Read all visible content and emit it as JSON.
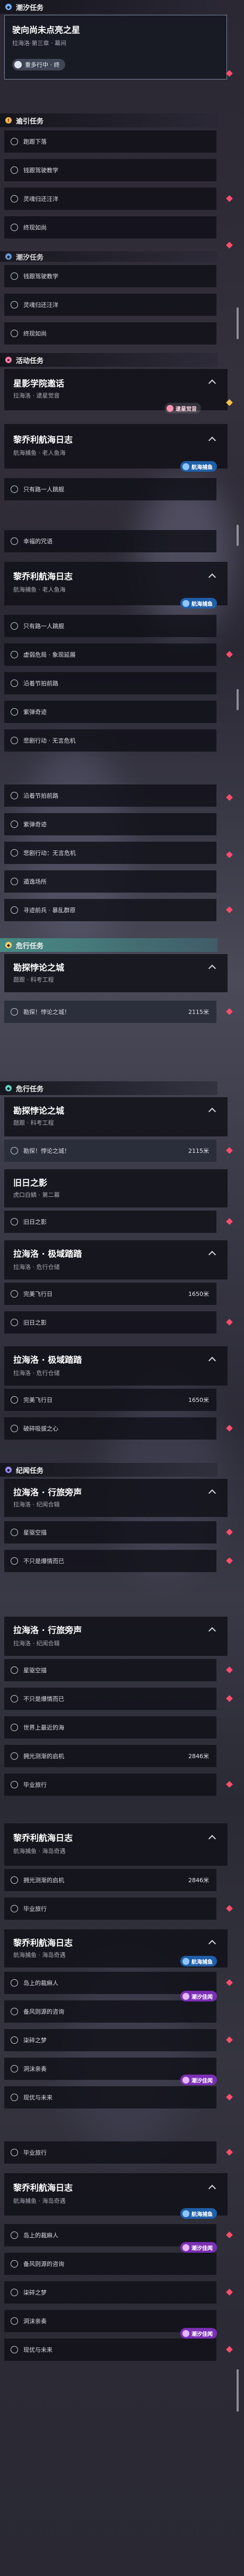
{
  "colors": {
    "accent_red": "#ff4d6d",
    "accent_teal": "#5fd4c4",
    "tag_blue": "#1f5fa8",
    "tag_purple": "#7b2fb5"
  },
  "sections": {
    "tide": "潮汐任务",
    "wander": "逾引任务",
    "activity": "活动任务",
    "realm": "危行任务",
    "side": "危行任务",
    "legend": "纪闻任务"
  },
  "top": {
    "title": "驶向尚未点亮之星",
    "subtitle": "拉海洛·第三章 · 幕间",
    "pill": "重多行中 · 终"
  },
  "wander_list": [
    "跑跟下落",
    "钱跟驾驶教学",
    "灵魂归还汪洋",
    "终现如尚"
  ],
  "wander_list2": [
    "钱跟驾驶教学",
    "灵魂归还汪洋",
    "终现如尚"
  ],
  "star_academy": {
    "title": "星影学院邀话",
    "subtitle": "拉海洛 · 逮星觉音",
    "tag": "逮星觉音"
  },
  "log1": {
    "title": "黎乔利航海日志",
    "subtitle": "航海捕鱼 · 老人鱼海",
    "tag": "航海捕鱼",
    "item": "只有路一人跳舰"
  },
  "mid_single": "幸福的咒语",
  "log2": {
    "title": "黎乔利航海日志",
    "subtitle": "航海捕鱼 · 老人鱼海",
    "tag": "航海捕鱼",
    "items": [
      "只有路一人跳舰",
      "虚弱危局 · 象现延展",
      "沿着节拍前路",
      "紫弹奇迹",
      "悲剧行动 · 无言危机"
    ]
  },
  "mid_list": [
    "沿着节拍前路",
    "紫弹奇迹",
    "悲剧行动：无言危机",
    "遁逸场所",
    "寻迹前兵 · 暴乱群原"
  ],
  "paradox1": {
    "title": "勘探悖论之城",
    "subtitle": "题跟 · 科考工程",
    "item": "勘探！悖论之城！",
    "dist": "2115米"
  },
  "paradox2": {
    "title": "勘探悖论之城",
    "subtitle": "题跟 · 科考工程",
    "item": "勘探！悖论之城！",
    "dist": "2115米"
  },
  "old_shadow": {
    "title": "旧日之影",
    "subtitle": "虎口白鳞 · 第二幕",
    "item": "旧日之影"
  },
  "pole1": {
    "title": "拉海洛 · 极域踏踏",
    "subtitle": "拉海洛 · 危行仓储",
    "item": "完美飞行日",
    "dist": "1650米",
    "extra": "旧日之影"
  },
  "pole2": {
    "title": "拉海洛 · 极域踏踏",
    "subtitle": "拉海洛 · 危行仓储",
    "item": "完美飞行日",
    "dist": "1650米",
    "extra": "破碎吸拔之心"
  },
  "lahai1": {
    "title": "拉海洛 · 行旅旁声",
    "subtitle": "拉海洛 · 纪闻合辑",
    "items": [
      "星驱空描",
      "不只是爆情而已"
    ]
  },
  "lahai2": {
    "title": "拉海洛 · 行旅旁声",
    "subtitle": "拉海洛 · 纪闻合辑",
    "items": [
      "星驱空描",
      "不只是爆情而已",
      "世界上最近的海",
      "拥光测渐的启机"
    ],
    "dist": "2846米",
    "extra": "毕业旅行"
  },
  "log3": {
    "title": "黎乔利航海日志",
    "subtitle": "航海捕鱼 · 海岛奇遇",
    "tag": "航海捕鱼",
    "before": "拥光测渐的启机",
    "before_dist": "2846米",
    "before2": "毕业旅行",
    "items": [
      "岛上的裁麻人",
      "备风则源的咨询",
      "柒碎之梦",
      "洞沫亲奏",
      "现优与未来"
    ],
    "tag2": "潮汐佳闻"
  },
  "log4": {
    "title": "黎乔利航海日志",
    "subtitle": "航海捕鱼 · 海岛奇遇",
    "tag": "航海捕鱼",
    "before": "毕业旅行",
    "items": [
      "岛上的裁麻人",
      "备风则源的咨询",
      "柒碎之梦",
      "洞沫亲奏",
      "现优与未来"
    ],
    "tag2": "潮汐佳闻"
  }
}
